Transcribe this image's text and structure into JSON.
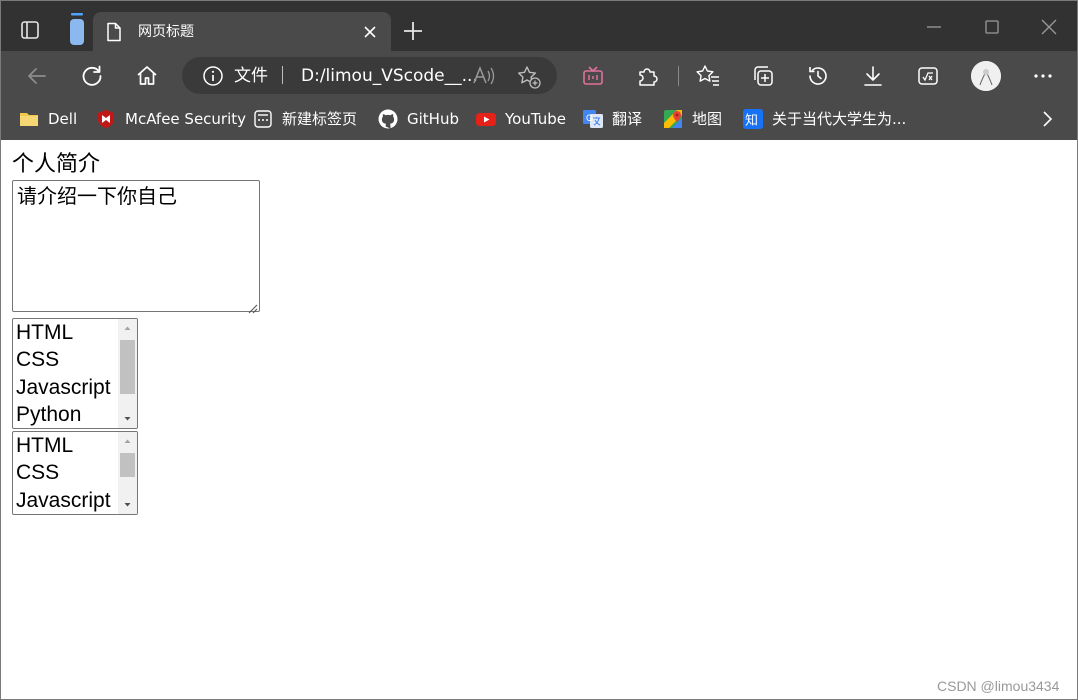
{
  "browser": {
    "tab": {
      "title": "网页标题",
      "favicon": "page-icon"
    },
    "address": {
      "scheme_label": "文件",
      "url": "D:/limou_VScode__...",
      "info_icon": "info-icon"
    },
    "bookmarks": [
      {
        "label": "Dell",
        "icon": "folder-icon",
        "color": "#f2c94c"
      },
      {
        "label": "McAfee Security",
        "icon": "mcafee-shield-icon",
        "color": "#c01818"
      },
      {
        "label": "新建标签页",
        "icon": "new-tab-page-icon",
        "color": "#ffffff"
      },
      {
        "label": "GitHub",
        "icon": "github-icon",
        "color": "#ffffff"
      },
      {
        "label": "YouTube",
        "icon": "youtube-icon",
        "color": "#e62117"
      },
      {
        "label": "翻译",
        "icon": "translate-icon",
        "color": "#4285f4"
      },
      {
        "label": "地图",
        "icon": "maps-icon",
        "color": "#34a853"
      },
      {
        "label": "关于当代大学生为...",
        "icon": "zhihu-icon",
        "color": "#1772f6"
      }
    ]
  },
  "page": {
    "intro_label": "个人简介",
    "textarea_value": "请介绍一下你自己",
    "listbox1": {
      "options": [
        "HTML",
        "CSS",
        "Javascript",
        "Python"
      ]
    },
    "listbox2": {
      "options": [
        "HTML",
        "CSS",
        "Javascript"
      ]
    }
  },
  "watermark": "CSDN @limou3434"
}
